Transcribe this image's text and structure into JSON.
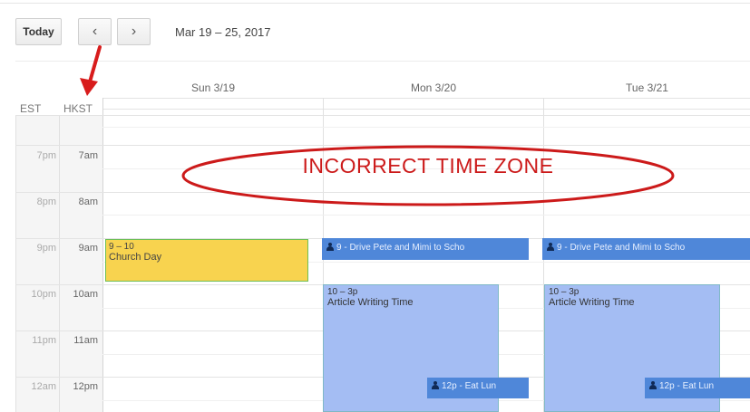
{
  "toolbar": {
    "today_label": "Today",
    "date_range": "Mar 19 – 25, 2017"
  },
  "timezones": {
    "left": "EST",
    "right": "HKST"
  },
  "days": [
    {
      "label": "Sun 3/19"
    },
    {
      "label": "Mon 3/20"
    },
    {
      "label": "Tue 3/21"
    }
  ],
  "times": [
    {
      "est": "7pm",
      "hkst": "7am"
    },
    {
      "est": "8pm",
      "hkst": "8am"
    },
    {
      "est": "9pm",
      "hkst": "9am"
    },
    {
      "est": "10pm",
      "hkst": "10am"
    },
    {
      "est": "11pm",
      "hkst": "11am"
    },
    {
      "est": "12am",
      "hkst": "12pm"
    }
  ],
  "events": {
    "church": {
      "time": "9 – 10",
      "title": "Church Day"
    },
    "drive_mon": {
      "text": "9 - Drive Pete and Mimi to Scho"
    },
    "drive_tue": {
      "text": "9 - Drive Pete and Mimi to Scho"
    },
    "writing_mon": {
      "time": "10 – 3p",
      "title": "Article Writing Time"
    },
    "writing_tue": {
      "time": "10 – 3p",
      "title": "Article Writing Time"
    },
    "lunch_mon": {
      "text": "12p - Eat Lun"
    },
    "lunch_tue": {
      "text": "12p - Eat Lun"
    }
  },
  "annotation": {
    "text": "INCORRECT TIME ZONE",
    "color": "#cc1a1a"
  },
  "colors": {
    "event_yellow": "#f8d34f",
    "event_blue": "#4f87d9",
    "event_light_blue": "#a4bdf3"
  }
}
